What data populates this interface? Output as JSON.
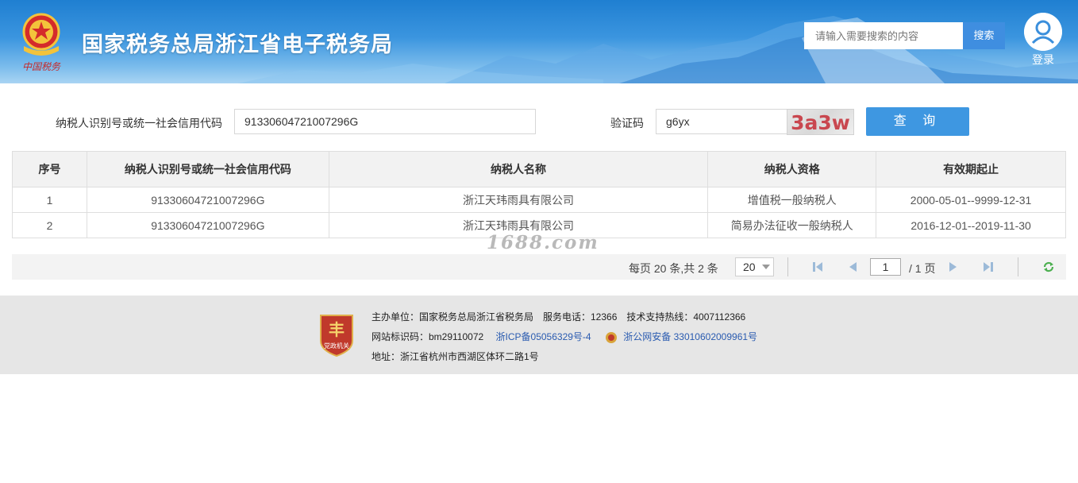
{
  "header": {
    "site_title": "国家税务总局浙江省电子税务局",
    "emblem_text": "中国税务",
    "search_placeholder": "请输入需要搜索的内容",
    "search_button": "搜索",
    "login_label": "登录",
    "colors": {
      "bar_top": "#1f7fd1",
      "bar_bottom": "#a9d4f3",
      "button": "#3f8ee0"
    }
  },
  "query": {
    "taxpayer_id_label": "纳税人识别号或统一社会信用代码",
    "taxpayer_id_value": "91330604721007296G",
    "captcha_label": "验证码",
    "captcha_value": "g6yx",
    "captcha_image_text": "3a3w",
    "query_button": "查 询"
  },
  "table": {
    "headers": [
      "序号",
      "纳税人识别号或统一社会信用代码",
      "纳税人名称",
      "纳税人资格",
      "有效期起止"
    ],
    "rows": [
      [
        "1",
        "91330604721007296G",
        "浙江天玮雨具有限公司",
        "增值税一般纳税人",
        "2000-05-01--9999-12-31"
      ],
      [
        "2",
        "91330604721007296G",
        "浙江天玮雨具有限公司",
        "简易办法征收一般纳税人",
        "2016-12-01--2019-11-30"
      ]
    ]
  },
  "watermark": "1688.com",
  "pager": {
    "summary": "每页 20 条,共 2 条",
    "page_size": "20",
    "current_page": "1",
    "total_pages": "/ 1 页",
    "icons": [
      "first-page-icon",
      "prev-page-icon",
      "next-page-icon",
      "last-page-icon",
      "refresh-icon"
    ]
  },
  "footer": {
    "badge_text": "党政机关",
    "line1": "主办单位：国家税务总局浙江省税务局　服务电话：12366　技术支持热线：4007112366",
    "site_code": "网站标识码：bm29110072",
    "icp": "浙ICP备05056329号-4",
    "police": "浙公网安备 33010602009961号",
    "address": "地址：浙江省杭州市西湖区体环二路1号"
  }
}
